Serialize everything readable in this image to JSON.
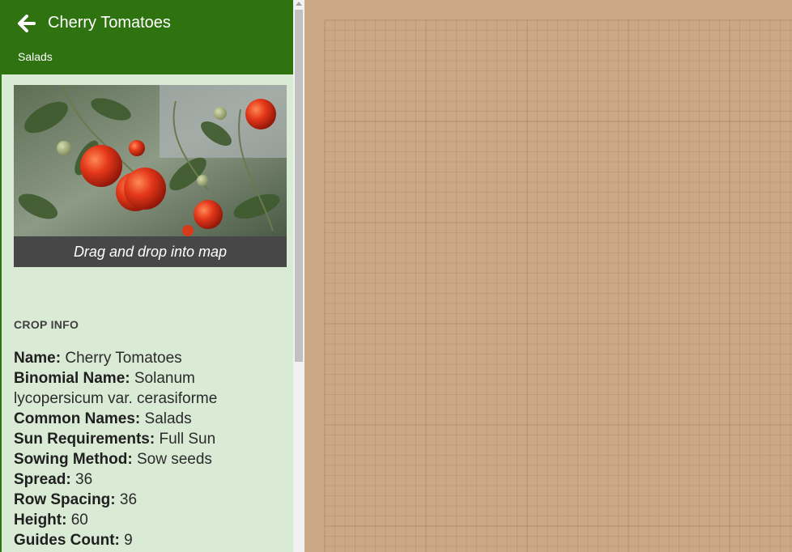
{
  "header": {
    "title": "Cherry Tomatoes",
    "subtitle": "Salads",
    "back_icon": "arrow-left-icon"
  },
  "photo": {
    "alt": "Cherry tomato plant",
    "caption": "Drag and drop into map"
  },
  "crop_info": {
    "section_label": "CROP INFO",
    "fields": [
      {
        "label": "Name:",
        "value": "Cherry Tomatoes"
      },
      {
        "label": "Binomial Name:",
        "value": "Solanum lycopersicum var. cerasiforme"
      },
      {
        "label": "Common Names:",
        "value": "Salads"
      },
      {
        "label": "Sun Requirements:",
        "value": "Full Sun"
      },
      {
        "label": "Sowing Method:",
        "value": "Sow seeds"
      },
      {
        "label": "Spread:",
        "value": "36"
      },
      {
        "label": "Row Spacing:",
        "value": "36"
      },
      {
        "label": "Height:",
        "value": "60"
      },
      {
        "label": "Guides Count:",
        "value": "9"
      }
    ]
  },
  "colors": {
    "header_green": "#2f7210",
    "panel_bg": "#d9ead5",
    "map_soil": "#cca886",
    "caption_bg": "#474747"
  }
}
